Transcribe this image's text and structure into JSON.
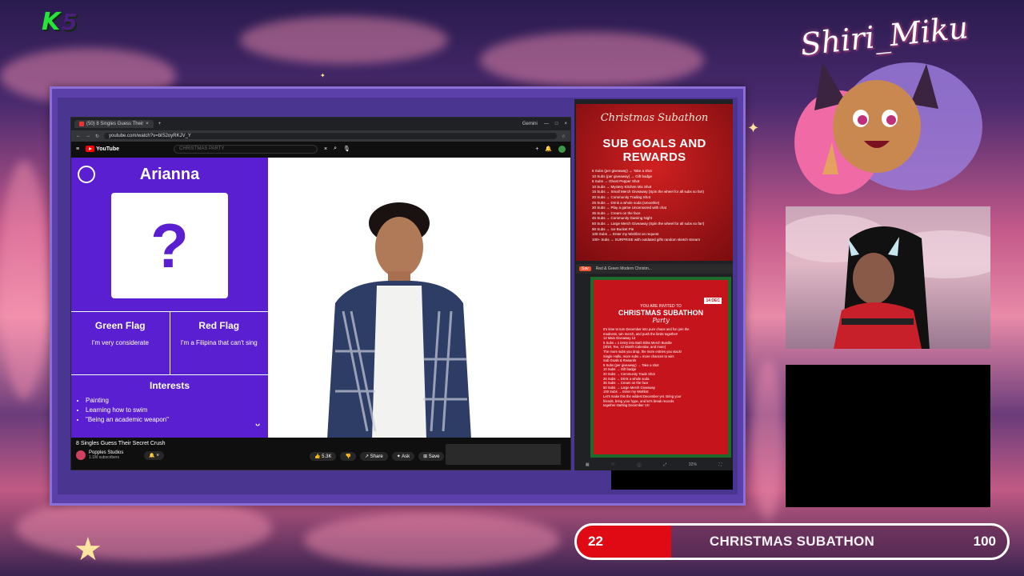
{
  "brand": {
    "letter": "K",
    "number": "5"
  },
  "streamer_name": "Shiri_Miku",
  "browser": {
    "tab_title": "(50) 8 Singles Guess Their",
    "extension_label": "Gemini",
    "url": "youtube.com/watch?v=bIS2oyRKJV_Y",
    "search_placeholder": "CHRISTMAS PARTY",
    "youtube_label": "YouTube"
  },
  "video": {
    "contestant_name": "Arianna",
    "question_mark": "?",
    "green_flag_heading": "Green Flag",
    "green_flag_text": "I'm very considerate",
    "red_flag_heading": "Red Flag",
    "red_flag_text": "I'm a Filipina that can't sing",
    "interests_heading": "Interests",
    "interests": [
      "Painting",
      "Learning how to swim",
      "\"Being an academic weapon\""
    ],
    "title": "8 Singles Guess Their Secret Crush",
    "channel_name": "Popples Studios",
    "channel_subs": "1.1M subscribers",
    "likes": "5.3K",
    "share_label": "Share",
    "ask_label": "Ask",
    "save_label": "Save"
  },
  "sub_goals": {
    "subtitle": "Christmas Subathon",
    "heading": "SUB GOALS AND REWARDS",
    "lines": [
      "5 Subs (per giveaway) → Take a shot",
      "10 Subs (per giveaway) → Gift badge",
      "5 Subs → Ghost Pepper Shot",
      "10 Subs → Mystery Kitchen Mix Shot",
      "15 Subs → Small Merch Giveaway (Spin the wheel for all subs so far!)",
      "20 Subs → Community Trading Shot",
      "25 Subs → Drink a whole soda (smoothie)",
      "30 Subs → Play a game Uncensored with chat",
      "35 Subs → Cream on the face",
      "45 Subs → Community Gaming Night",
      "50 Subs → Large Merch Giveaway (Spin the wheel for all subs so far!)",
      "90 Subs → Ice Bucket Pie",
      "100 Subs → Enter my Wishlist on request",
      "100+ Subs → SURPRISE with outdated gifts random sketch stream"
    ]
  },
  "invite": {
    "panel_title": "Red & Green Modern Christm...",
    "badge": "Sav",
    "caption": "YOU ARE INVITED TO",
    "heading": "CHRISTMAS SUBATHON",
    "party": "Party",
    "date": "14 DEC",
    "body": [
      "It's time to turn December into pure chaos and fun join the",
      "madness, win merch, and push the limits together!",
      "12 Main Giveaway 12",
      "5 Subs = 1 Entry into Bath Bliss Merch Bundle",
      "(Shirt, Tee, 12 Month Calendar, and more)",
      "The more subs you drop, the more entries you stack!",
      "Single Hallo, more subs = more chances to win!",
      "Sub Goals & Rewards",
      "5 Subs (per giveaway) → Take a shot",
      "10 Subs → Gift badge",
      "20 Subs → Community Trade Shot",
      "25 Subs → Drink a whole soda",
      "35 Subs → Cream on the face",
      "50 Subs → Large Merch Giveaway",
      "100 Subs → Enter my Wishlist",
      "Let's make this the wildest December yet. Bring your",
      "friends, bring your hype, and let's break records",
      "together starting December 14!"
    ],
    "zoom": "32%"
  },
  "subathon": {
    "title": "CHRISTMAS SUBATHON",
    "current": 22,
    "goal": 100
  }
}
